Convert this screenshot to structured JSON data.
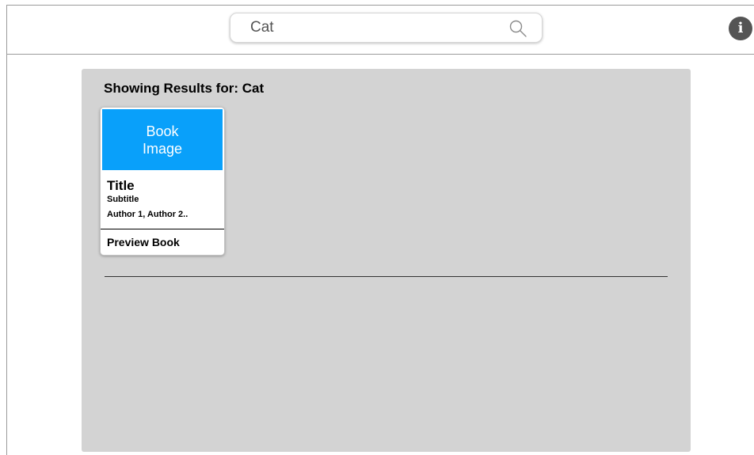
{
  "search": {
    "value": "Cat",
    "icon": "search-icon"
  },
  "header": {
    "info_icon_label": "i"
  },
  "results": {
    "heading": "Showing Results for: Cat",
    "books": [
      {
        "image_label": "Book Image",
        "title": "Title",
        "subtitle": "Subtitle",
        "authors": "Author 1, Author 2..",
        "action_label": "Preview Book"
      }
    ]
  },
  "colors": {
    "panel_background": "#d3d3d3",
    "book_image_background": "#09a0fa",
    "info_icon_background": "#545454"
  }
}
